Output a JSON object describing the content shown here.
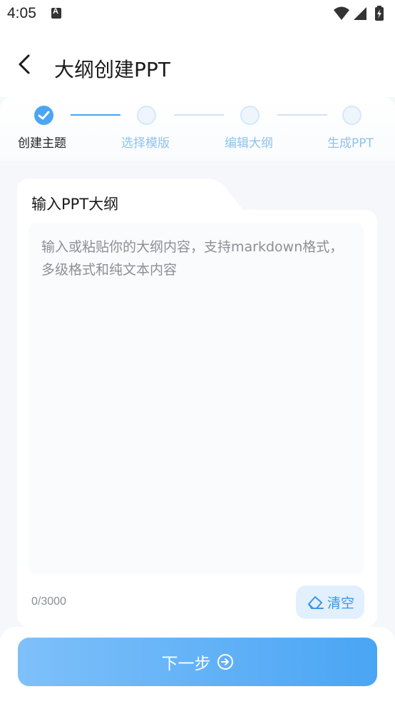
{
  "status_bar": {
    "time": "4:05",
    "notification_icon": "keyboard-a-icon",
    "wifi_icon": "wifi-icon",
    "signal_icon": "signal-icon",
    "battery_icon": "battery-charging-icon"
  },
  "header": {
    "back_icon": "chevron-left-icon",
    "title": "大纲创建PPT"
  },
  "steps": [
    {
      "label": "创建主题",
      "state": "done"
    },
    {
      "label": "选择模版",
      "state": "todo"
    },
    {
      "label": "编辑大纲",
      "state": "todo"
    },
    {
      "label": "生成PPT",
      "state": "todo"
    }
  ],
  "outline_card": {
    "title": "输入PPT大纲",
    "input_value": "",
    "placeholder": "输入或粘贴你的大纲内容，支持markdown格式，多级格式和纯文本内容",
    "char_count": "0/3000",
    "clear_label": "清空",
    "clear_icon": "eraser-icon"
  },
  "footer": {
    "next_label": "下一步",
    "next_icon": "arrow-right-circle-icon"
  },
  "colors": {
    "accent": "#4aa5f4",
    "accent_light": "#7ec0fa",
    "inactive_step": "#8ec3ef"
  }
}
